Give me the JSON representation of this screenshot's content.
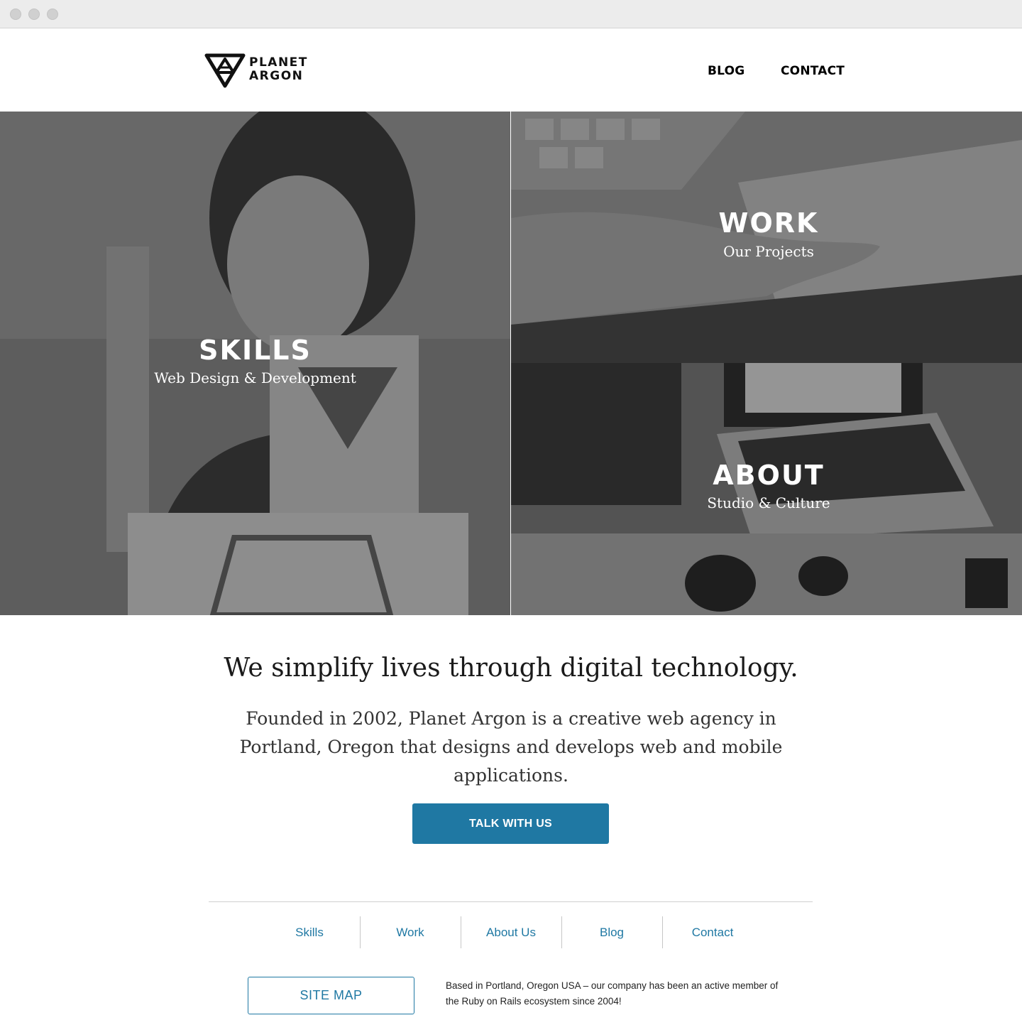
{
  "brand": {
    "line1": "PLANET",
    "line2": "ARGON"
  },
  "nav": {
    "blog": "BLOG",
    "contact": "CONTACT"
  },
  "tiles": {
    "skills": {
      "title": "SKILLS",
      "subtitle": "Web Design & Development"
    },
    "work": {
      "title": "WORK",
      "subtitle": "Our Projects"
    },
    "about": {
      "title": "ABOUT",
      "subtitle": "Studio & Culture"
    }
  },
  "intro": {
    "headline": "We simplify lives through digital technology.",
    "body": "Founded in 2002, Planet Argon is a creative web agency in Portland, Oregon that designs and develops web and mobile applications.",
    "cta": "TALK WITH US"
  },
  "footer": {
    "links": [
      "Skills",
      "Work",
      "About Us",
      "Blog",
      "Contact"
    ],
    "sitemap": "SITE MAP",
    "note": "Based in Portland, Oregon USA – our company has been an active member of the Ruby on Rails ecosystem since 2004!"
  },
  "colors": {
    "accent": "#1f78a3",
    "text": "#111111"
  }
}
